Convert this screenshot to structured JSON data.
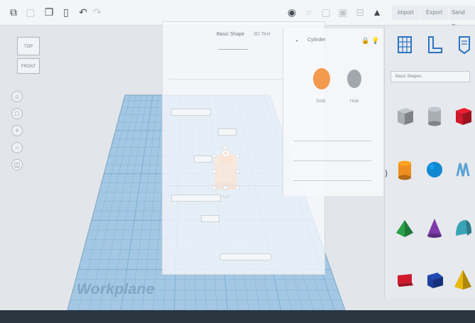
{
  "toolbar": {
    "icons": [
      "copy-icon",
      "paste-icon",
      "duplicate-icon",
      "delete-icon",
      "undo-icon",
      "redo-icon"
    ],
    "view_icons": [
      "camera-icon",
      "light-bulb-icon",
      "group-icon",
      "ungroup-icon",
      "align-icon",
      "mirror-icon"
    ],
    "buttons": [
      "Import",
      "Export",
      "Send To"
    ]
  },
  "viewcube": {
    "top_label": "TOP",
    "front_label": "FRONT"
  },
  "workplane": {
    "label": "Workplane"
  },
  "shape_panel": {
    "tab_active": "Basic Shape",
    "tab_inactive": "3D Text"
  },
  "inspector": {
    "selected_shape": "Cylinder",
    "solid_label": "Solid",
    "hole_label": "Hole",
    "colors": {
      "solid": "#f39a4c",
      "hole": "#a3a8ae"
    }
  },
  "library": {
    "dropdown": "Basic Shapes",
    "top_icons": [
      "grid-icon",
      "ruler-icon",
      "notes-icon"
    ],
    "shapes": [
      {
        "name": "box-hole-icon",
        "color": "#a9aeb4"
      },
      {
        "name": "cylinder-hole-icon",
        "color": "#a9aeb4"
      },
      {
        "name": "box-icon",
        "color": "#d0192b"
      },
      {
        "name": "cylinder-icon",
        "color": "#ee8e1f"
      },
      {
        "name": "sphere-icon",
        "color": "#1188d0"
      },
      {
        "name": "scribble-icon",
        "color": "#5aa3d8"
      },
      {
        "name": "roof-icon",
        "color": "#2aa04a"
      },
      {
        "name": "cone-icon",
        "color": "#7b3aa8"
      },
      {
        "name": "round-roof-icon",
        "color": "#3aa3b6"
      },
      {
        "name": "text-icon",
        "color": "#d0192b"
      },
      {
        "name": "wedge-icon",
        "color": "#1d3f9e"
      },
      {
        "name": "pyramid-icon",
        "color": "#e8b70e"
      }
    ]
  },
  "bottombar": {}
}
